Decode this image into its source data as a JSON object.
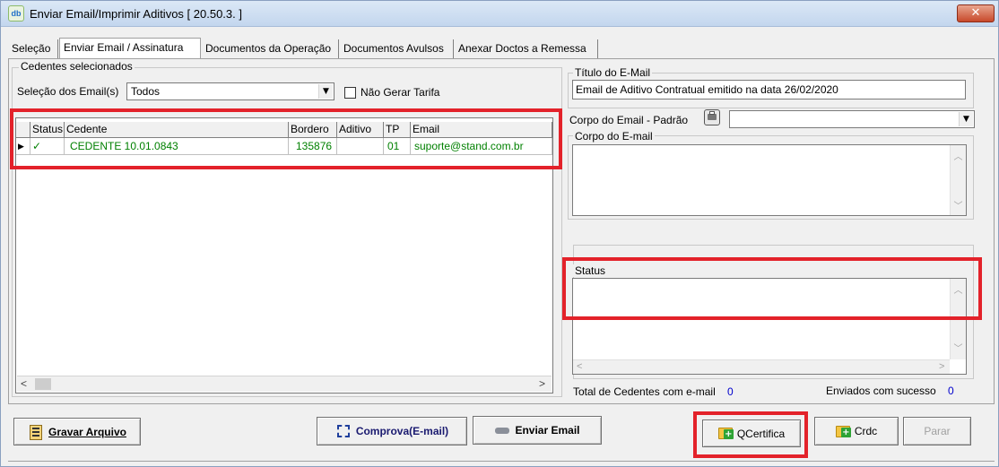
{
  "window": {
    "app_icon_text": "db",
    "title": "Enviar Email/Imprimir Aditivos [ 20.50.3. ]",
    "close_symbol": "✕"
  },
  "tabs": [
    {
      "label": "Seleção",
      "active": false
    },
    {
      "label": "Enviar Email / Assinatura",
      "active": true
    },
    {
      "label": "Documentos da Operação",
      "active": false
    },
    {
      "label": "Documentos Avulsos",
      "active": false
    },
    {
      "label": "Anexar Doctos a Remessa",
      "active": false
    }
  ],
  "cedentes": {
    "group_label": "Cedentes selecionados",
    "selection_label": "Seleção dos Email(s)",
    "selection_value": "Todos",
    "nao_gerar_tarifa_label": "Não Gerar Tarifa",
    "nao_gerar_tarifa_checked": false,
    "grid": {
      "columns": [
        "Status",
        "Cedente",
        "Bordero",
        "Aditivo",
        "TP",
        "Email"
      ],
      "rows": [
        {
          "indicator": "▶",
          "status": "✓",
          "cedente": "CEDENTE 10.01.0843",
          "bordero": "135876",
          "aditivo": "",
          "tp": "01",
          "email": "suporte@stand.com.br"
        }
      ]
    }
  },
  "email": {
    "titulo_label": "Título do E-Mail",
    "titulo_value": "Email de Aditivo Contratual emitido na data 26/02/2020",
    "corpo_padrao_label": "Corpo do Email - Padrão",
    "corpo_padrao_value": "",
    "corpo_label": "Corpo do E-mail",
    "corpo_value": "",
    "status_label": "Status",
    "status_value": ""
  },
  "totals": {
    "total_label": "Total de Cedentes com e-mail",
    "total_value": "0",
    "enviados_label": "Enviados com sucesso",
    "enviados_value": "0"
  },
  "buttons": {
    "gravar": "Gravar Arquivo",
    "comprova": "Comprova(E-mail)",
    "enviar": "Enviar Email",
    "qcertifica": "QCertifica",
    "crdc": "Crdc",
    "parar": "Parar"
  },
  "colors": {
    "highlight_red": "#e3222a",
    "grid_text_green": "#008000",
    "count_blue": "#0000cc"
  }
}
